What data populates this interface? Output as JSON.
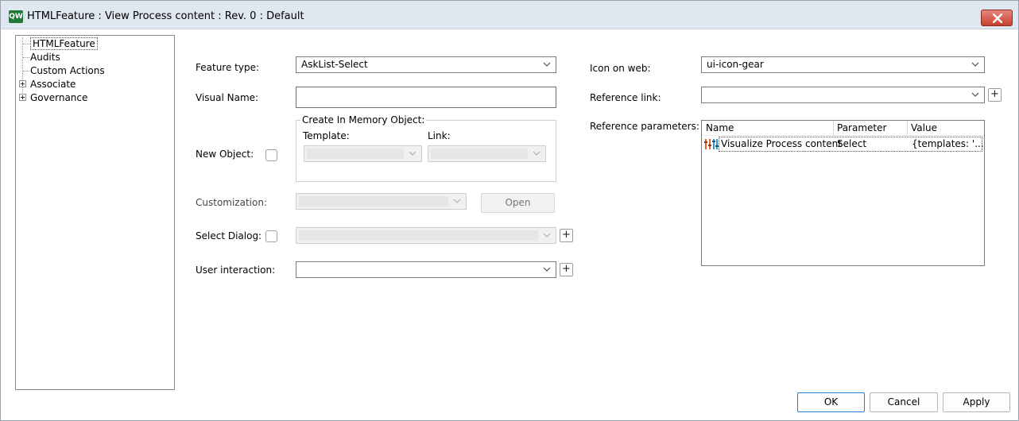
{
  "window": {
    "app_badge": "QW",
    "title": "HTMLFeature : View Process content : Rev. 0  : Default",
    "close_icon": "close-icon"
  },
  "tree": {
    "items": [
      {
        "label": "HTMLFeature",
        "selected": true,
        "expandable": false
      },
      {
        "label": "Audits",
        "selected": false,
        "expandable": false
      },
      {
        "label": "Custom Actions",
        "selected": false,
        "expandable": false
      },
      {
        "label": "Associate",
        "selected": false,
        "expandable": true
      },
      {
        "label": "Governance",
        "selected": false,
        "expandable": true
      }
    ]
  },
  "form": {
    "feature_type": {
      "label": "Feature type:",
      "value": "AskList-Select"
    },
    "visual_name": {
      "label": "Visual Name:",
      "value": ""
    },
    "new_object": {
      "label": "New Object:",
      "checked": false
    },
    "create_in_memory": {
      "legend": "Create In Memory Object:",
      "template_label": "Template:",
      "template_value": "",
      "link_label": "Link:",
      "link_value": ""
    },
    "customization": {
      "label": "Customization:",
      "value": "",
      "open_button": "Open"
    },
    "select_dialog": {
      "label": "Select Dialog:",
      "checked": false,
      "value": "",
      "add": "+"
    },
    "user_interaction": {
      "label": "User interaction:",
      "value": "",
      "add": "+"
    },
    "icon_on_web": {
      "label": "Icon on web:",
      "value": "ui-icon-gear"
    },
    "reference_link": {
      "label": "Reference link:",
      "value": "",
      "add": "+"
    },
    "reference_parameters": {
      "label": "Reference parameters:",
      "columns": [
        "Name",
        "Parameter",
        "Value"
      ],
      "rows": [
        {
          "icon": "parameter-icon",
          "name": "Visualize Process content",
          "parameter": "Select",
          "value": "{templates: '..."
        }
      ]
    }
  },
  "footer": {
    "ok": "OK",
    "cancel": "Cancel",
    "apply": "Apply"
  },
  "colors": {
    "titlebar": "#dfe7f0",
    "close_button": "#c6412f",
    "app_badge": "#1f7a3a",
    "default_button_border": "#2d7bd4"
  }
}
